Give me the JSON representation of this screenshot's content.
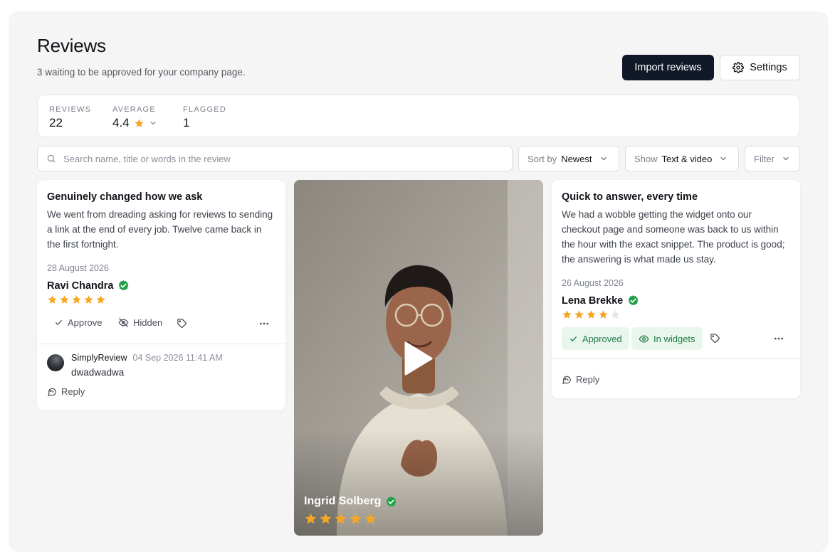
{
  "header": {
    "title": "Reviews",
    "subtitle": "3 waiting to be approved for your company page.",
    "import_label": "Import reviews",
    "settings_label": "Settings"
  },
  "stats": [
    {
      "label": "REVIEWS",
      "value": "22"
    },
    {
      "label": "AVERAGE",
      "value": "4.4"
    },
    {
      "label": "FLAGGED",
      "value": "1"
    }
  ],
  "toolbar": {
    "search_placeholder": "Search name, title or words in the review",
    "sort_key": "Sort by",
    "sort_value": "Newest",
    "show_key": "Show",
    "show_value": "Text & video",
    "filter_label": "Filter"
  },
  "cards": [
    {
      "title": "Genuinely changed how we ask",
      "body": "We went from dreading asking for reviews to sending a link at the end of every job. Twelve came back in the first fortnight.",
      "date": "28 August 2026",
      "name": "Ravi Chandra",
      "rating": 5,
      "approve_label": "Approve",
      "hidden_label": "Hidden",
      "comment": {
        "author": "SimplyReview",
        "time": "04 Sep 2026 11:41 AM",
        "text": "dwadwadwa"
      },
      "reply_label": "Reply"
    },
    {
      "name": "Ingrid Solberg",
      "rating": 5
    },
    {
      "title": "Quick to answer, every time",
      "body": "We had a wobble getting the widget onto our checkout page and someone was back to us within the hour with the exact snippet. The product is good; the answering is what made us stay.",
      "date": "26 August 2026",
      "name": "Lena Brekke",
      "rating": 4,
      "approved_label": "Approved",
      "widgets_label": "In widgets",
      "reply_label": "Reply"
    }
  ],
  "colors": {
    "star": "#f5a623",
    "star_empty": "#e3e4e6",
    "verified": "#22a045",
    "primary": "#111827",
    "approved_bg": "#e8f6ee",
    "approved_text": "#1f7a42"
  },
  "icons": [
    "gear-icon",
    "star-icon",
    "chevron-down-icon",
    "search-icon",
    "verified-icon",
    "check-icon",
    "eye-off-icon",
    "tag-icon",
    "more-icon",
    "reply-icon",
    "eye-icon",
    "play-icon"
  ]
}
